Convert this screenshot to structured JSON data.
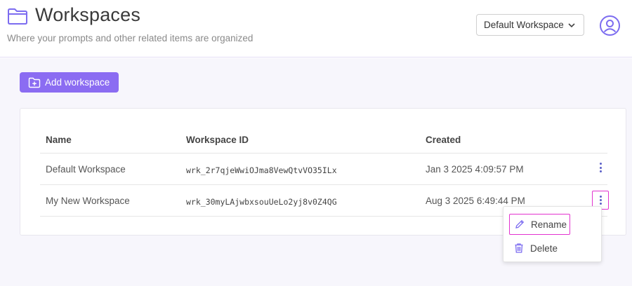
{
  "header": {
    "title": "Workspaces",
    "subtitle": "Where your prompts and other related items are organized",
    "workspace_select": "Default Workspace",
    "folder_icon": "folder-icon",
    "user_icon": "user-circle-icon"
  },
  "toolbar": {
    "add_label": "Add workspace"
  },
  "table": {
    "columns": [
      "Name",
      "Workspace ID",
      "Created"
    ],
    "rows": [
      {
        "name": "Default Workspace",
        "id": "wrk_2r7qjeWwiOJma8VewQtvVO35ILx",
        "created": "Jan 3 2025 4:09:57 PM"
      },
      {
        "name": "My New Workspace",
        "id": "wrk_30myLAjwbxsouUeLo2yj8v0Z4QG",
        "created": "Aug 3 2025 6:49:44 PM"
      }
    ]
  },
  "context_menu": {
    "items": [
      {
        "label": "Rename",
        "icon": "pencil-icon"
      },
      {
        "label": "Delete",
        "icon": "trash-icon"
      }
    ]
  },
  "colors": {
    "accent": "#8b6cf2",
    "highlight": "#e233cf",
    "icon": "#7c6cf0"
  }
}
